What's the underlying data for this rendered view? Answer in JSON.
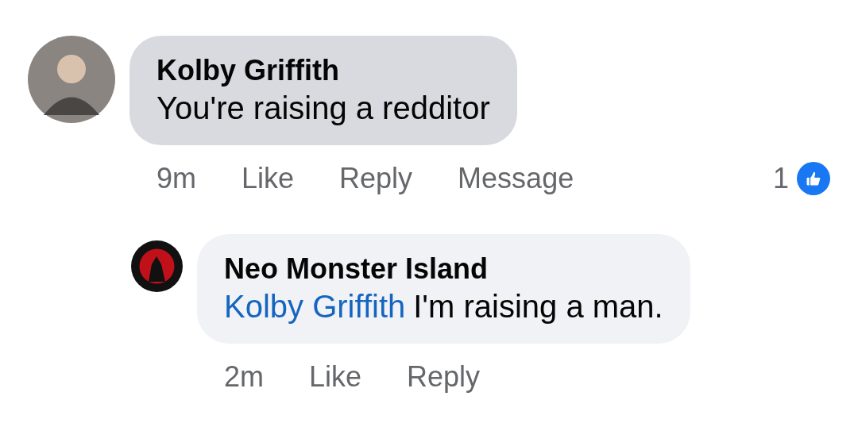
{
  "comments": [
    {
      "author": "Kolby Griffith",
      "highlighted": true,
      "text": "You're raising a redditor",
      "time": "9m",
      "actions": [
        "Like",
        "Reply",
        "Message"
      ],
      "reactions": "1",
      "replies": [
        {
          "author": "Neo Monster Island",
          "highlighted": false,
          "mention": "Kolby Griffith",
          "text": "I'm raising a man.",
          "time": "2m",
          "actions": [
            "Like",
            "Reply"
          ]
        }
      ]
    }
  ]
}
